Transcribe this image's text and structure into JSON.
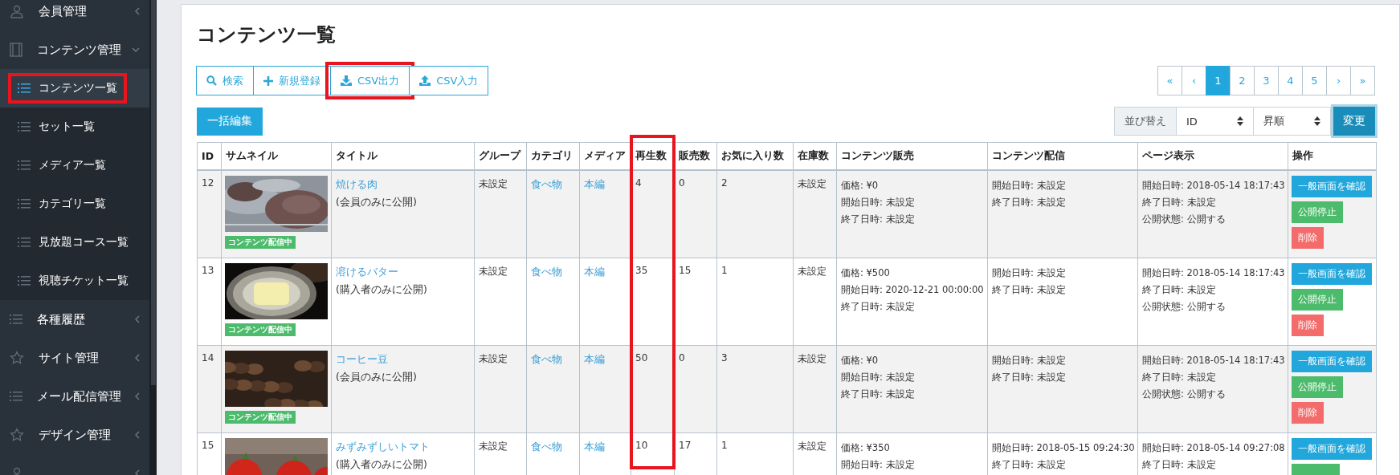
{
  "sidebar": {
    "items": [
      {
        "label": "会員管理",
        "expanded": false
      },
      {
        "label": "コンテンツ管理",
        "expanded": true,
        "children": [
          {
            "label": "コンテンツ一覧",
            "selected": true,
            "highlighted": true
          },
          {
            "label": "セット一覧",
            "selected": false,
            "highlighted": false
          },
          {
            "label": "メディア一覧",
            "selected": false,
            "highlighted": false
          },
          {
            "label": "カテゴリ一覧",
            "selected": false,
            "highlighted": false
          },
          {
            "label": "見放題コース一覧",
            "selected": false,
            "highlighted": false
          },
          {
            "label": "視聴チケット一覧",
            "selected": false,
            "highlighted": false
          }
        ]
      },
      {
        "label": "各種履歴",
        "expanded": false
      },
      {
        "label": "サイト管理",
        "expanded": false
      },
      {
        "label": "メール配信管理",
        "expanded": false
      },
      {
        "label": "デザイン管理",
        "expanded": false
      },
      {
        "expanded": false
      }
    ]
  },
  "page_title": "コンテンツ一覧",
  "toolbar": [
    {
      "label": "検索",
      "highlighted": false
    },
    {
      "label": "新規登録",
      "highlighted": false
    },
    {
      "label": "CSV出力",
      "highlighted": true
    },
    {
      "label": "CSV入力",
      "highlighted": false
    }
  ],
  "bulk_edit_button": "一括編集",
  "pagination": [
    {
      "label": "«",
      "selected": false
    },
    {
      "label": "‹",
      "selected": false
    },
    {
      "label": "1",
      "selected": true
    },
    {
      "label": "2",
      "selected": false
    },
    {
      "label": "3",
      "selected": false
    },
    {
      "label": "4",
      "selected": false
    },
    {
      "label": "5",
      "selected": false
    },
    {
      "label": "›",
      "selected": false
    },
    {
      "label": "»",
      "selected": false
    }
  ],
  "sort": {
    "label": "並び替え",
    "field": "ID",
    "order": "昇順",
    "button": "変更"
  },
  "table": {
    "columns": [
      {
        "label": "ID",
        "highlighted": false
      },
      {
        "label": "サムネイル",
        "highlighted": false
      },
      {
        "label": "タイトル",
        "highlighted": false
      },
      {
        "label": "グループ",
        "highlighted": false
      },
      {
        "label": "カテゴリ",
        "highlighted": false
      },
      {
        "label": "メディア",
        "highlighted": false
      },
      {
        "label": "再生数",
        "highlighted": true
      },
      {
        "label": "販売数",
        "highlighted": false
      },
      {
        "label": "お気に入り数",
        "highlighted": false
      },
      {
        "label": "在庫数",
        "highlighted": false
      },
      {
        "label": "コンテンツ販売",
        "highlighted": false
      },
      {
        "label": "コンテンツ配信",
        "highlighted": false
      },
      {
        "label": "ページ表示",
        "highlighted": false
      },
      {
        "label": "操作",
        "highlighted": false
      }
    ],
    "rows": [
      {
        "id": "12",
        "status_badge": "コンテンツ配信中",
        "title": "焼ける肉",
        "visibility": "(会員のみに公開)",
        "group": "未設定",
        "category": "食べ物",
        "media": "本編",
        "plays": "4",
        "sales": "0",
        "favorites": "2",
        "stock": "未設定",
        "sale": [
          "価格: ¥0",
          "開始日時:  未設定",
          "終了日時:  未設定"
        ],
        "delivery": [
          "開始日時:  未設定",
          "終了日時:  未設定"
        ],
        "page_display": [
          "開始日時:  2018-05-14 18:17:43",
          "終了日時:  未設定",
          "公開状態: 公開する"
        ],
        "actions": [
          {
            "label": "一般画面を確認",
            "kind": "view"
          },
          {
            "label": "公開停止",
            "kind": "stop"
          },
          {
            "label": "削除",
            "kind": "delete"
          }
        ]
      },
      {
        "id": "13",
        "status_badge": "コンテンツ配信中",
        "title": "溶けるバター",
        "visibility": "(購入者のみに公開)",
        "group": "未設定",
        "category": "食べ物",
        "media": "本編",
        "plays": "35",
        "sales": "15",
        "favorites": "1",
        "stock": "未設定",
        "sale": [
          "価格: ¥500",
          "開始日時:  2020-12-21 00:00:00",
          "終了日時:  未設定"
        ],
        "delivery": [
          "開始日時:  未設定",
          "終了日時:  未設定"
        ],
        "page_display": [
          "開始日時:  2018-05-14 18:17:43",
          "終了日時:  未設定",
          "公開状態: 公開する"
        ],
        "actions": [
          {
            "label": "一般画面を確認",
            "kind": "view"
          },
          {
            "label": "公開停止",
            "kind": "stop"
          },
          {
            "label": "削除",
            "kind": "delete"
          }
        ]
      },
      {
        "id": "14",
        "status_badge": "コンテンツ配信中",
        "title": "コーヒー豆",
        "visibility": "(会員のみに公開)",
        "group": "未設定",
        "category": "食べ物",
        "media": "本編",
        "plays": "50",
        "sales": "0",
        "favorites": "3",
        "stock": "未設定",
        "sale": [
          "価格: ¥0",
          "開始日時:  未設定",
          "終了日時:  未設定"
        ],
        "delivery": [
          "開始日時:  未設定",
          "終了日時:  未設定"
        ],
        "page_display": [
          "開始日時:  2018-05-14 18:17:43",
          "終了日時:  未設定",
          "公開状態: 公開する"
        ],
        "actions": [
          {
            "label": "一般画面を確認",
            "kind": "view"
          },
          {
            "label": "公開停止",
            "kind": "stop"
          },
          {
            "label": "削除",
            "kind": "delete"
          }
        ]
      },
      {
        "id": "15",
        "title": "みずみずしいトマト",
        "visibility": "(購入者のみに公開)",
        "group": "未設定",
        "category": "食べ物",
        "media": "本編",
        "plays": "10",
        "sales": "17",
        "favorites": "1",
        "stock": "未設定",
        "sale": [
          "価格: ¥350",
          "開始日時:  未設定"
        ],
        "delivery": [
          "開始日時:  2018-05-15 09:24:30",
          "終了日時:  未設定"
        ],
        "page_display": [
          "開始日時:  2018-05-14 09:27:08",
          "終了日時:  未設定"
        ],
        "actions": [
          {
            "label": "一般画面を確認",
            "kind": "view"
          },
          {
            "kind": "stop"
          }
        ]
      }
    ]
  }
}
